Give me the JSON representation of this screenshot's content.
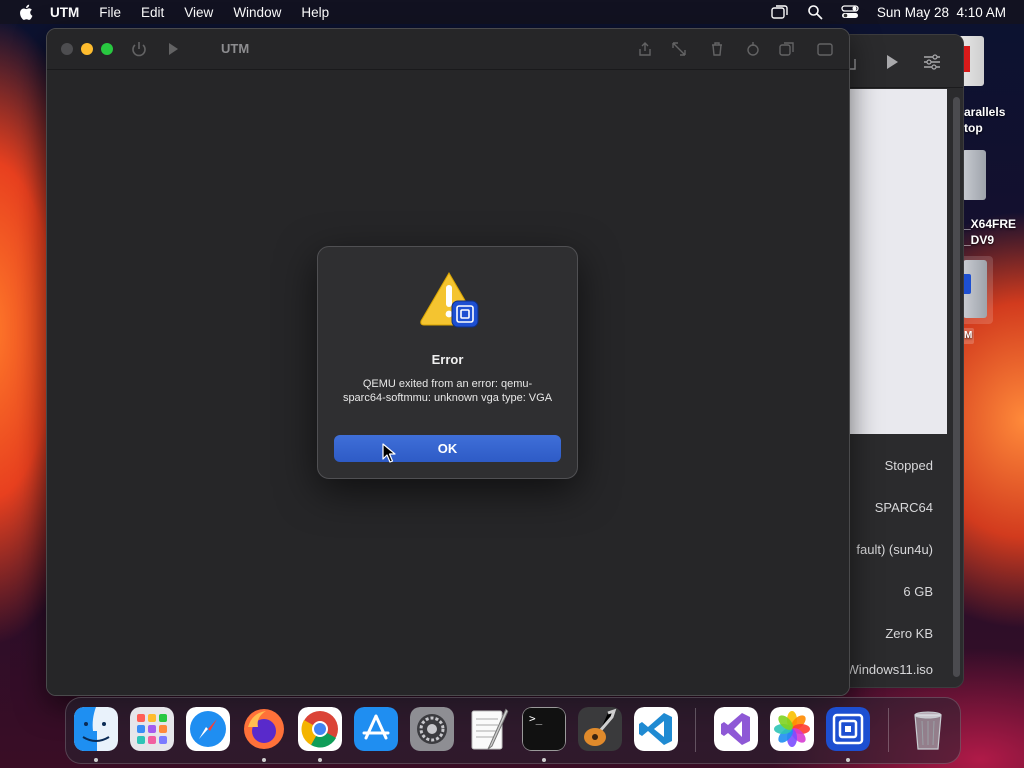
{
  "menubar": {
    "apple_icon": "apple-icon",
    "app_name": "UTM",
    "items": [
      "File",
      "Edit",
      "View",
      "Window",
      "Help"
    ],
    "right_icons": [
      "screen-mirroring-icon",
      "spotlight-search-icon",
      "control-center-icon"
    ],
    "clock": "Sun May 28  4:10 AM"
  },
  "utm_window": {
    "title": "UTM",
    "toolbar_icons": [
      "power-icon",
      "play-icon",
      "share-icon",
      "resize-icon",
      "trash-icon",
      "usb-icon",
      "clone-icon",
      "window-icon"
    ]
  },
  "alert": {
    "icon": "warning-utm-icon",
    "heading": "Error",
    "message": "QEMU exited from an error: qemu-sparc64-softmmu: unknown vga type: VGA",
    "ok_label": "OK"
  },
  "back_window": {
    "toolbar_icons": [
      "share-icon",
      "play-icon",
      "settings-sliders-icon"
    ],
    "details": {
      "status": "Stopped",
      "architecture": "SPARC64",
      "machine": "fault) (sun4u)",
      "memory": "6 GB",
      "size": "Zero KB",
      "cd_dvd": "Windows11.iso"
    }
  },
  "desktop": {
    "labels": {
      "parallels_line1": "arallels",
      "parallels_line2": "top",
      "iso_line1": "_X64FRE",
      "iso_line2": "_DV9",
      "utm_tag": "M"
    }
  },
  "dock": {
    "apps": [
      {
        "name": "Finder",
        "icon": "finder-icon"
      },
      {
        "name": "Launchpad",
        "icon": "launchpad-icon"
      },
      {
        "name": "Safari",
        "icon": "safari-icon"
      },
      {
        "name": "Firefox",
        "icon": "firefox-icon"
      },
      {
        "name": "Google Chrome",
        "icon": "chrome-icon"
      },
      {
        "name": "App Store",
        "icon": "app-store-icon"
      },
      {
        "name": "System Settings",
        "icon": "system-settings-icon"
      },
      {
        "name": "TextEdit",
        "icon": "textedit-icon"
      },
      {
        "name": "Terminal",
        "icon": "terminal-icon"
      },
      {
        "name": "GarageBand",
        "icon": "garageband-icon"
      },
      {
        "name": "Visual Studio Code",
        "icon": "vscode-icon"
      },
      {
        "name": "Visual Studio",
        "icon": "visual-studio-icon"
      },
      {
        "name": "Photos",
        "icon": "photos-icon"
      },
      {
        "name": "UTM",
        "icon": "utm-icon"
      },
      {
        "name": "Trash",
        "icon": "trash-icon"
      }
    ],
    "terminal_prompt": ">_"
  },
  "colors": {
    "accent_button": "#2e5bc6",
    "traffic_close": "#ff5f57",
    "traffic_minimize": "#febc2e",
    "traffic_zoom": "#28c840",
    "window_bg": "#262628"
  }
}
